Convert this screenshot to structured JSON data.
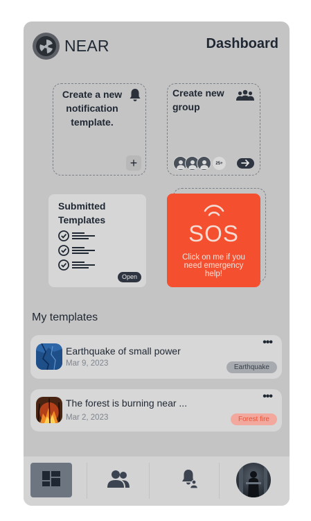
{
  "header": {
    "brand": "NEAR",
    "title": "Dashboard"
  },
  "cards": {
    "notification": {
      "title": "Create a new notification template."
    },
    "group": {
      "title": "Create new group",
      "avatar_count": "25+"
    },
    "submitted": {
      "title": "Submitted Templates",
      "open_label": "Open"
    },
    "sos": {
      "label": "SOS",
      "text": "Click on me if you need emergency help!"
    }
  },
  "templates": {
    "section_title": "My templates",
    "items": [
      {
        "title": "Earthquake of small power",
        "date": "Mar 9, 2023",
        "tag": "Earthquake"
      },
      {
        "title": "The forest is burning near ...",
        "date": "Mar 2, 2023",
        "tag": "Forest fire"
      }
    ],
    "more_label": "•••"
  },
  "icons": {
    "logo": "near-logo-icon",
    "bell": "bell-icon",
    "group": "group-icon",
    "plus": "plus-icon",
    "arrow": "arrow-right-icon",
    "check": "check-circle-icon",
    "signal": "signal-waves-icon",
    "home": "dashboard-grid-icon",
    "people": "people-icon",
    "notify": "bell-user-icon"
  },
  "colors": {
    "background": "#c4c4c4",
    "accent_sos": "#f4502f",
    "dark": "#2e3540",
    "tag_fire": "#e8533a"
  }
}
